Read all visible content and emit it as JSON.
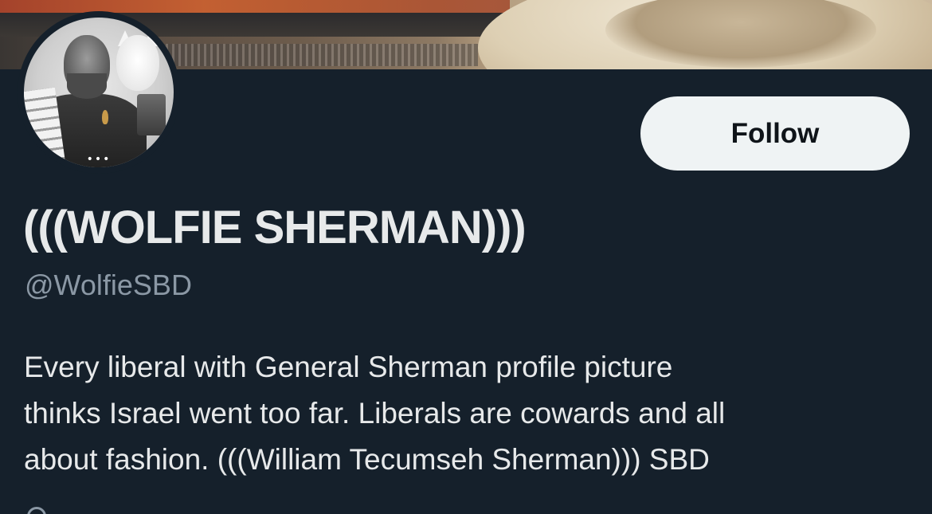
{
  "profile": {
    "display_name": "(((WOLFIE SHERMAN)))",
    "handle": "@WolfieSBD",
    "bio_lines": [
      "Every liberal with General Sherman profile picture",
      "thinks Israel went too far. Liberals are cowards and all",
      "about fashion. (((William Tecumseh Sherman))) SBD"
    ],
    "avatar_more_glyph": "•••"
  },
  "actions": {
    "follow_label": "Follow"
  },
  "theme": {
    "background": "#15202b",
    "primary_text": "#e7e9ea",
    "secondary_text": "#8b98a5",
    "button_background": "#eff3f4",
    "button_text": "#0f1419"
  }
}
